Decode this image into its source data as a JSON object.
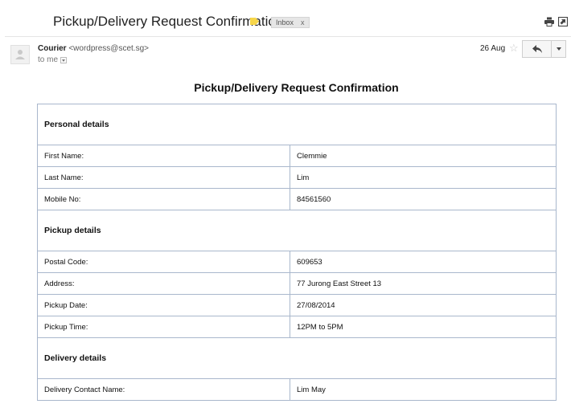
{
  "subject": {
    "title": "Pickup/Delivery Request Confirmation",
    "label_color": "#f7d64a",
    "inbox_chip": {
      "label": "Inbox",
      "remove": "x"
    }
  },
  "toolbar": {
    "print_icon": "print-icon",
    "popout_icon": "open-in-new-window-icon"
  },
  "message": {
    "sender_name": "Courier",
    "sender_email": "<wordpress@scet.sg>",
    "recipient": "to me",
    "date": "26 Aug",
    "star_icon": "star-outline-icon",
    "reply_icon": "reply-arrow-icon",
    "more_icon": "chevron-down-icon"
  },
  "body": {
    "title": "Pickup/Delivery Request Confirmation",
    "sections": [
      {
        "heading": "Personal details",
        "rows": [
          {
            "label": "First Name:",
            "value": "Clemmie"
          },
          {
            "label": "Last Name:",
            "value": "Lim"
          },
          {
            "label": "Mobile No:",
            "value": "84561560"
          }
        ]
      },
      {
        "heading": "Pickup details",
        "rows": [
          {
            "label": "Postal Code:",
            "value": "609653"
          },
          {
            "label": "Address:",
            "value": "77 Jurong East Street 13"
          },
          {
            "label": "Pickup Date:",
            "value": "27/08/2014"
          },
          {
            "label": "Pickup Time:",
            "value": "12PM to 5PM"
          }
        ]
      },
      {
        "heading": "Delivery details",
        "rows": [
          {
            "label": "Delivery Contact Name:",
            "value": "Lim May"
          }
        ]
      }
    ]
  }
}
